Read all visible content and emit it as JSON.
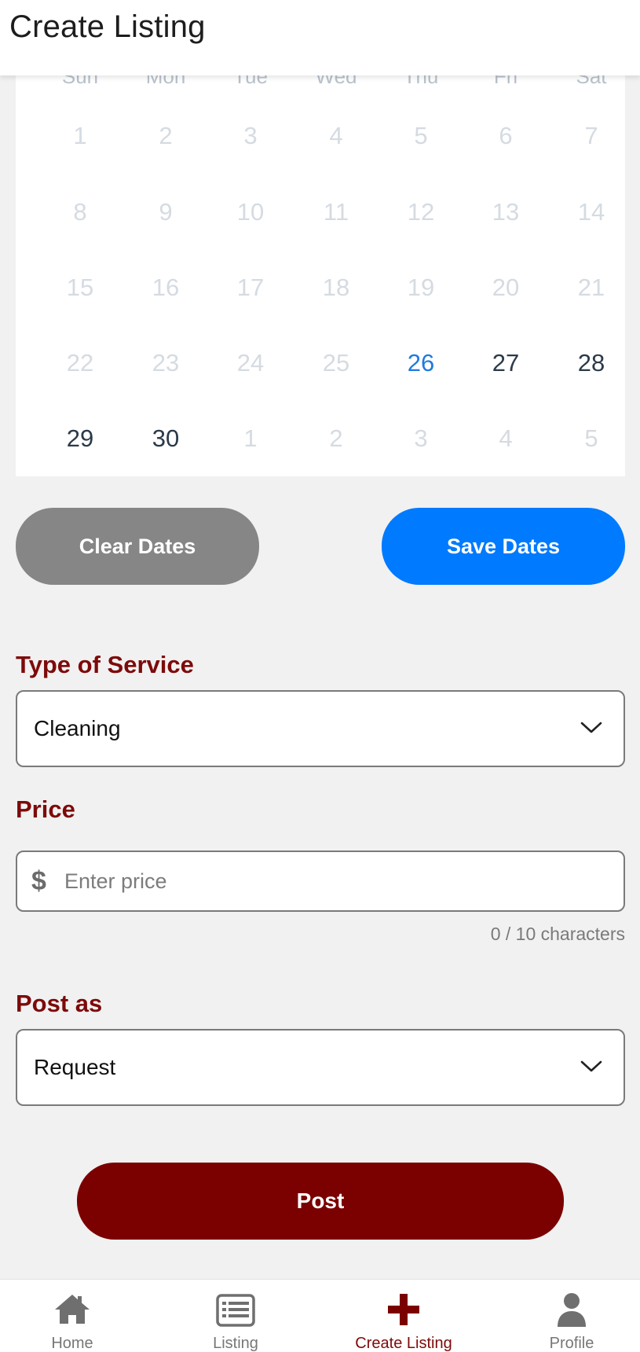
{
  "header": {
    "title": "Create Listing"
  },
  "calendar": {
    "weekdays": [
      "Sun",
      "Mon",
      "Tue",
      "Wed",
      "Thu",
      "Fri",
      "Sat"
    ],
    "weeks": [
      [
        {
          "d": "1",
          "s": "disabled"
        },
        {
          "d": "2",
          "s": "disabled"
        },
        {
          "d": "3",
          "s": "disabled"
        },
        {
          "d": "4",
          "s": "disabled"
        },
        {
          "d": "5",
          "s": "disabled"
        },
        {
          "d": "6",
          "s": "disabled"
        },
        {
          "d": "7",
          "s": "disabled"
        }
      ],
      [
        {
          "d": "8",
          "s": "disabled"
        },
        {
          "d": "9",
          "s": "disabled"
        },
        {
          "d": "10",
          "s": "disabled"
        },
        {
          "d": "11",
          "s": "disabled"
        },
        {
          "d": "12",
          "s": "disabled"
        },
        {
          "d": "13",
          "s": "disabled"
        },
        {
          "d": "14",
          "s": "disabled"
        }
      ],
      [
        {
          "d": "15",
          "s": "disabled"
        },
        {
          "d": "16",
          "s": "disabled"
        },
        {
          "d": "17",
          "s": "disabled"
        },
        {
          "d": "18",
          "s": "disabled"
        },
        {
          "d": "19",
          "s": "disabled"
        },
        {
          "d": "20",
          "s": "disabled"
        },
        {
          "d": "21",
          "s": "disabled"
        }
      ],
      [
        {
          "d": "22",
          "s": "disabled"
        },
        {
          "d": "23",
          "s": "disabled"
        },
        {
          "d": "24",
          "s": "disabled"
        },
        {
          "d": "25",
          "s": "disabled"
        },
        {
          "d": "26",
          "s": "today"
        },
        {
          "d": "27",
          "s": "available"
        },
        {
          "d": "28",
          "s": "available"
        }
      ],
      [
        {
          "d": "29",
          "s": "available"
        },
        {
          "d": "30",
          "s": "available"
        },
        {
          "d": "1",
          "s": "disabled"
        },
        {
          "d": "2",
          "s": "disabled"
        },
        {
          "d": "3",
          "s": "disabled"
        },
        {
          "d": "4",
          "s": "disabled"
        },
        {
          "d": "5",
          "s": "disabled"
        }
      ]
    ]
  },
  "date_actions": {
    "clear_label": "Clear Dates",
    "save_label": "Save Dates"
  },
  "form": {
    "service": {
      "label": "Type of Service",
      "value": "Cleaning"
    },
    "price": {
      "label": "Price",
      "currency_symbol": "$",
      "placeholder": "Enter price",
      "value": "",
      "char_count": "0 / 10 characters"
    },
    "post_as": {
      "label": "Post as",
      "value": "Request"
    },
    "submit_label": "Post"
  },
  "bottom_nav": {
    "items": [
      {
        "label": "Home",
        "icon": "home-icon",
        "active": false
      },
      {
        "label": "Listing",
        "icon": "list-icon",
        "active": false
      },
      {
        "label": "Create Listing",
        "icon": "plus-icon",
        "active": true
      },
      {
        "label": "Profile",
        "icon": "person-icon",
        "active": false
      }
    ]
  },
  "colors": {
    "accent_red": "#7b0000",
    "label_red": "#7d0a0a",
    "save_blue": "#007afe",
    "clear_gray": "#868686",
    "today_blue": "#1f7ae0",
    "nav_gray": "#777777"
  }
}
